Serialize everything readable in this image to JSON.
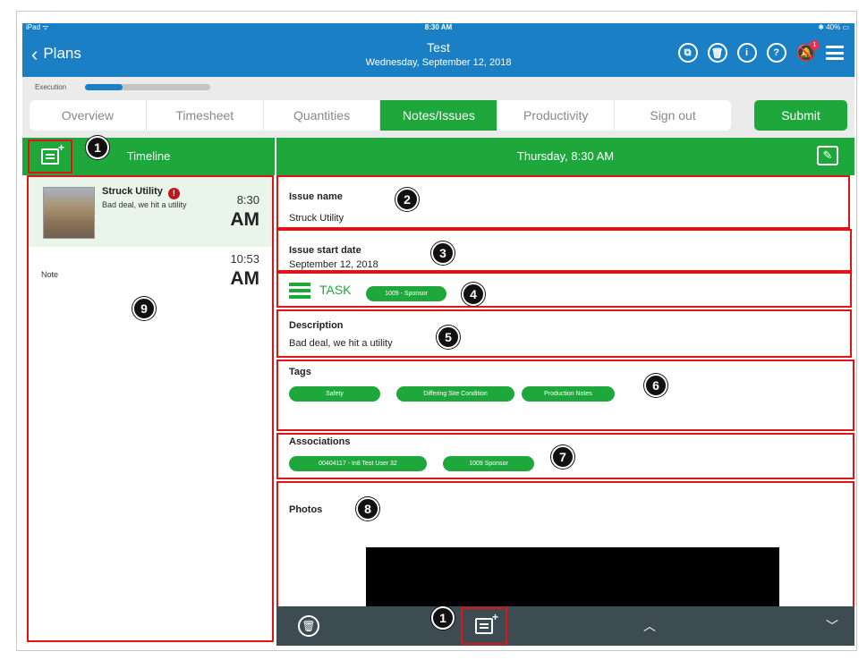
{
  "status_bar": {
    "device": "iPad ᯤ",
    "time": "8:30 AM",
    "battery": "✱ 40% ▭"
  },
  "nav": {
    "back_label": "Plans",
    "title": "Test",
    "subtitle": "Wednesday, September 12, 2018",
    "notification_count": "1",
    "icons": [
      "copy-icon",
      "trash-icon",
      "info-icon",
      "help-icon",
      "bell-off-icon",
      "menu-icon"
    ]
  },
  "execution": {
    "label": "Execution",
    "progress": 0.3
  },
  "tabs": [
    {
      "label": "Overview",
      "active": false
    },
    {
      "label": "Timesheet",
      "active": false
    },
    {
      "label": "Quantities",
      "active": false
    },
    {
      "label": "Notes/Issues",
      "active": true
    },
    {
      "label": "Productivity",
      "active": false
    },
    {
      "label": "Sign out",
      "active": false
    }
  ],
  "submit_label": "Submit",
  "timeline": {
    "header": "Timeline",
    "items": [
      {
        "title": "Struck Utility",
        "subtitle": "Bad deal, we hit a utility",
        "time": "8:30",
        "ampm": "AM"
      },
      {
        "title": "Note",
        "time": "10:53",
        "ampm": "AM"
      }
    ]
  },
  "detail": {
    "header": "Thursday, 8:30 AM",
    "issue_name_label": "Issue name",
    "issue_name_value": "Struck Utility",
    "start_date_label": "Issue start date",
    "start_date_value": "September 12, 2018",
    "task_label": "TASK",
    "task_pill": "1009 - Sponsor",
    "description_label": "Description",
    "description_value": "Bad deal, we hit a utility",
    "tags_label": "Tags",
    "tags": [
      "Safety",
      "Differing Site Condition",
      "Production Notes"
    ],
    "associations_label": "Associations",
    "associations": [
      "00404117 - In8 Test User 32",
      "1009 Sponsor"
    ],
    "photos_label": "Photos"
  },
  "callouts": [
    "1",
    "2",
    "3",
    "4",
    "5",
    "6",
    "7",
    "8",
    "9",
    "1"
  ],
  "colors": {
    "nav_blue": "#1a7fc4",
    "green": "#1ea83c",
    "highlight_red": "#e01414",
    "toolbar": "#3d4b52"
  }
}
